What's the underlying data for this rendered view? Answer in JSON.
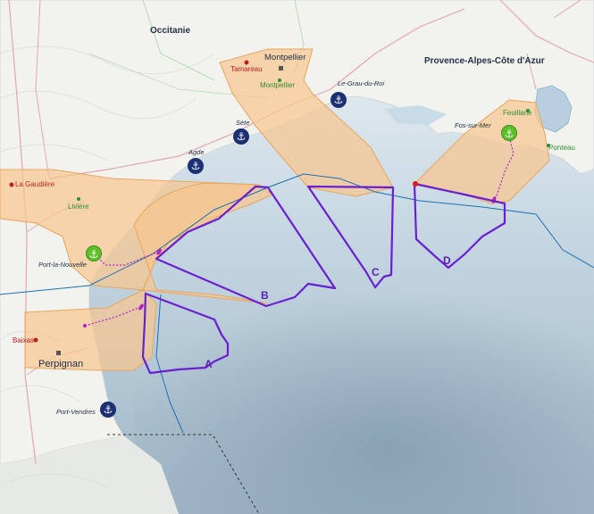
{
  "regions": {
    "occitanie": "Occitanie",
    "paca": "Provence-Alpes-Côte d'Azur"
  },
  "cities": {
    "montpellier": "Montpellier",
    "perpignan": "Perpignan"
  },
  "red_sites": {
    "tamareau": "Tamareau",
    "la_gaudiere": "La Gaudière",
    "baixas": "Baixas"
  },
  "green_sites": {
    "montpellier": "Montpellier",
    "liviere": "Livière",
    "feuillane": "Feuillane",
    "ponteau": "Ponteau"
  },
  "ports": {
    "le_grau_du_roi": "Le-Grau-du-Roi",
    "sete": "Sète",
    "agde": "Agde",
    "port_la_nouvelle": "Port-la-Nouvelle",
    "fos_sur_mer": "Fos-sur-Mer",
    "port_vendres": "Port-Vendres"
  },
  "zones": {
    "a": "A",
    "b": "B",
    "c": "C",
    "d": "D"
  },
  "colors": {
    "land": "#f3f3f1",
    "sea_light": "#dce7ee",
    "sea_dark": "#7f9aae",
    "corridor_fill": "#f6c68f",
    "corridor_stroke": "#e9a55e",
    "zone_stroke": "#6a1fd0",
    "anchor_blue": "#1b2f73",
    "anchor_green": "#5cbf2a",
    "cable": "#b21fc9"
  },
  "icons": {
    "port": "anchor-icon",
    "hub_port": "anchor-green-icon"
  }
}
